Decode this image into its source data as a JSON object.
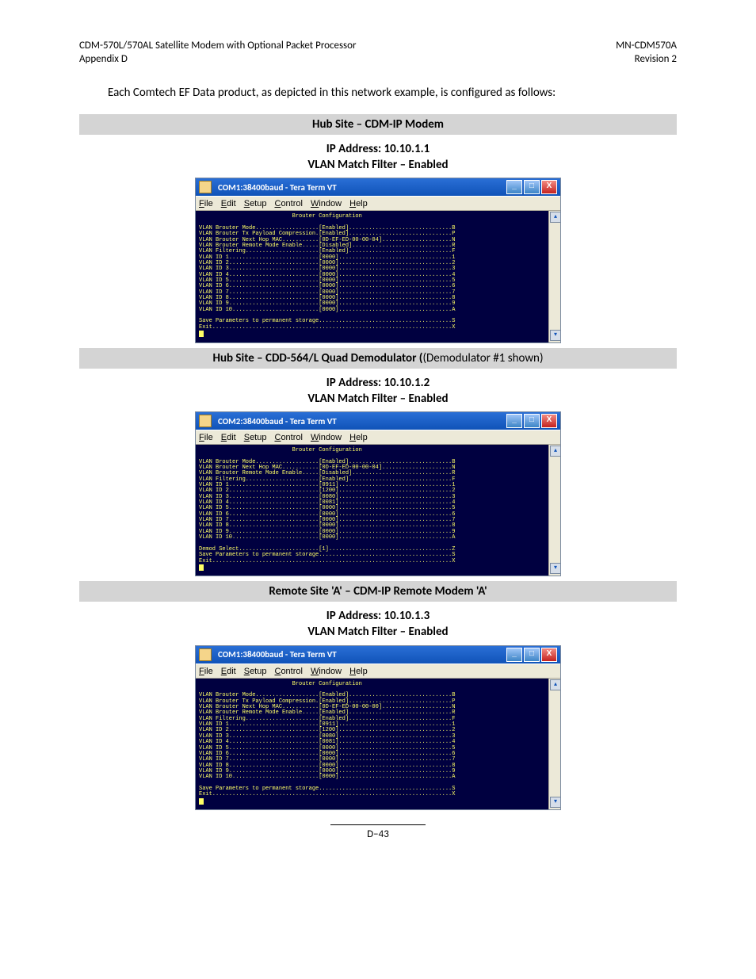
{
  "header": {
    "top_left_1": "CDM-570L/570AL Satellite Modem with Optional Packet Processor",
    "top_left_2": "Appendix D",
    "top_right_1": "MN-CDM570A",
    "top_right_2": "Revision 2"
  },
  "intro": "Each Comtech EF Data product, as depicted in this network example, is configured as follows:",
  "page_number": "D–43",
  "terminal_common": {
    "menu_file": "File",
    "menu_edit": "Edit",
    "menu_setup": "Setup",
    "menu_control": "Control",
    "menu_window": "Window",
    "menu_help": "Help",
    "body_title": "Brouter Configuration",
    "win_min": "_",
    "win_max": "□",
    "win_close": "X",
    "scroll_up": "▴",
    "scroll_dn": "▾"
  },
  "sections": [
    {
      "bar": "Hub Site – CDM-IP Modem",
      "sub1": "IP Address: 10.10.1.1",
      "sub2": "VLAN Match Filter – Enabled",
      "term_title": "COM1:38400baud - Tera Term VT",
      "rows": [
        {
          "label": "VLAN Brouter Mode",
          "value": "[Enabled]",
          "key": "B"
        },
        {
          "label": "VLAN Brouter Tx Payload Compression",
          "value": "[Enabled]",
          "key": "P"
        },
        {
          "label": "VLAN Brouter Next Hop MAC",
          "value": "[0D-EF-ED-00-00-04]",
          "key": "N"
        },
        {
          "label": "VLAN Brouter Remote Mode Enable",
          "value": "[Disabled]",
          "key": "R"
        },
        {
          "label": "VLAN Filtering",
          "value": "[Enabled]",
          "key": "F"
        },
        {
          "label": "VLAN ID 1",
          "value": "[0000]",
          "key": "1"
        },
        {
          "label": "VLAN ID 2",
          "value": "[0000]",
          "key": "2"
        },
        {
          "label": "VLAN ID 3",
          "value": "[0000]",
          "key": "3"
        },
        {
          "label": "VLAN ID 4",
          "value": "[0000]",
          "key": "4"
        },
        {
          "label": "VLAN ID 5",
          "value": "[0000]",
          "key": "5"
        },
        {
          "label": "VLAN ID 6",
          "value": "[0000]",
          "key": "6"
        },
        {
          "label": "VLAN ID 7",
          "value": "[0000]",
          "key": "7"
        },
        {
          "label": "VLAN ID 8",
          "value": "[0000]",
          "key": "8"
        },
        {
          "label": "VLAN ID 9",
          "value": "[0000]",
          "key": "9"
        },
        {
          "label": "VLAN ID 10",
          "value": "[0000]",
          "key": "A"
        }
      ],
      "footer_rows": [
        {
          "label": "Save Parameters to permanent storage",
          "key": "S"
        },
        {
          "label": "Exit",
          "key": "X"
        }
      ]
    },
    {
      "bar_prefix": "Hub Site – CDD-564/L Quad Demodulator (",
      "bar_suffix": "(Demodulator #1 shown)",
      "sub1": "IP Address: 10.10.1.2",
      "sub2": "VLAN Match Filter – Enabled",
      "term_title": "COM2:38400baud - Tera Term VT",
      "rows": [
        {
          "label": "VLAN Brouter Mode",
          "value": "[Enabled]",
          "key": "B"
        },
        {
          "label": "VLAN Brouter Next Hop MAC",
          "value": "[0D-EF-ED-00-00-04]",
          "key": "N"
        },
        {
          "label": "VLAN Brouter Remote Mode Enable",
          "value": "[Disabled]",
          "key": "R"
        },
        {
          "label": "VLAN Filtering",
          "value": "[Enabled]",
          "key": "F"
        },
        {
          "label": "VLAN ID 1",
          "value": "[0911]",
          "key": "1"
        },
        {
          "label": "VLAN ID 2",
          "value": "[1200]",
          "key": "2"
        },
        {
          "label": "VLAN ID 3",
          "value": "[0080]",
          "key": "3"
        },
        {
          "label": "VLAN ID 4",
          "value": "[0081]",
          "key": "4"
        },
        {
          "label": "VLAN ID 5",
          "value": "[0000]",
          "key": "5"
        },
        {
          "label": "VLAN ID 6",
          "value": "[0000]",
          "key": "6"
        },
        {
          "label": "VLAN ID 7",
          "value": "[0000]",
          "key": "7"
        },
        {
          "label": "VLAN ID 8",
          "value": "[0000]",
          "key": "8"
        },
        {
          "label": "VLAN ID 9",
          "value": "[0000]",
          "key": "9"
        },
        {
          "label": "VLAN ID 10",
          "value": "[0000]",
          "key": "A"
        }
      ],
      "footer_rows": [
        {
          "label": "Demod Select",
          "value": "[1]",
          "key": "Z"
        },
        {
          "label": "Save Parameters to permanent storage",
          "key": "S"
        },
        {
          "label": "Exit",
          "key": "X"
        }
      ]
    },
    {
      "bar": "Remote Site 'A' – CDM-IP Remote Modem 'A'",
      "sub1": "IP Address: 10.10.1.3",
      "sub2": "VLAN Match Filter – Enabled",
      "term_title": "COM1:38400baud - Tera Term VT",
      "rows": [
        {
          "label": "VLAN Brouter Mode",
          "value": "[Enabled]",
          "key": "B"
        },
        {
          "label": "VLAN Brouter Tx Payload Compression",
          "value": "[Enabled]",
          "key": "P"
        },
        {
          "label": "VLAN Brouter Next Hop MAC",
          "value": "[0D-EF-ED-00-00-00]",
          "key": "N"
        },
        {
          "label": "VLAN Brouter Remote Mode Enable",
          "value": "[Enabled]",
          "key": "R"
        },
        {
          "label": "VLAN Filtering",
          "value": "[Enabled]",
          "key": "F"
        },
        {
          "label": "VLAN ID 1",
          "value": "[0911]",
          "key": "1"
        },
        {
          "label": "VLAN ID 2",
          "value": "[1200]",
          "key": "2"
        },
        {
          "label": "VLAN ID 3",
          "value": "[0080]",
          "key": "3"
        },
        {
          "label": "VLAN ID 4",
          "value": "[0081]",
          "key": "4"
        },
        {
          "label": "VLAN ID 5",
          "value": "[0000]",
          "key": "5"
        },
        {
          "label": "VLAN ID 6",
          "value": "[0000]",
          "key": "6"
        },
        {
          "label": "VLAN ID 7",
          "value": "[0000]",
          "key": "7"
        },
        {
          "label": "VLAN ID 8",
          "value": "[0000]",
          "key": "8"
        },
        {
          "label": "VLAN ID 9",
          "value": "[0000]",
          "key": "9"
        },
        {
          "label": "VLAN ID 10",
          "value": "[0000]",
          "key": "A"
        }
      ],
      "footer_rows": [
        {
          "label": "Save Parameters to permanent storage",
          "key": "S"
        },
        {
          "label": "Exit",
          "key": "X"
        }
      ]
    }
  ]
}
